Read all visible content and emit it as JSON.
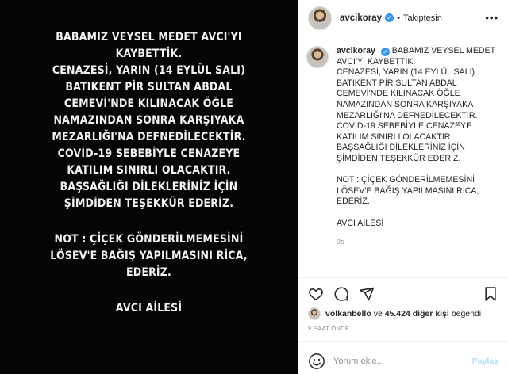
{
  "image": {
    "lines": [
      "BABAMIZ VEYSEL MEDET AVCI'YI",
      "KAYBETTİK.",
      "CENAZESİ, YARIN (14 EYLÜL SALI)",
      "BATIKENT PİR SULTAN ABDAL",
      "CEMEVİ'NDE KILINACAK ÖĞLE",
      "NAMAZINDAN SONRA KARŞIYAKA",
      "MEZARLIĞI'NA DEFNEDİLECEKTİR.",
      "COVİD-19 SEBEBİYLE CENAZEYE",
      "KATILIM SINIRLI OLACAKTIR.",
      "BAŞSAĞLIĞI DİLEKLERİNİZ İÇİN",
      "ŞİMDİDEN TEŞEKKÜR EDERİZ.",
      "",
      "NOT : ÇİÇEK GÖNDERİLMEMESİNİ",
      "LÖSEV'E BAĞIŞ YAPILMASINI RİCA,",
      "EDERİZ.",
      "",
      "AVCI AİLESİ"
    ]
  },
  "header": {
    "username": "avcikoray",
    "separator": "•",
    "follow_status": "Takiptesin",
    "more": "•••"
  },
  "caption": {
    "username": "avcikoray",
    "first_line": "BABAMIZ VEYSEL MEDET",
    "lines": [
      "AVCI'YI KAYBETTİK.",
      "CENAZESİ, YARIN (14 EYLÜL SALI)",
      "BATIKENT PİR SULTAN ABDAL",
      "CEMEVİ'NDE KILINACAK ÖĞLE",
      "NAMAZINDAN SONRA KARŞIYAKA",
      "MEZARLIĞI'NA DEFNEDİLECEKTİR.",
      "COVİD-19 SEBEBİYLE CENAZEYE",
      "KATILIM SINIRLI OLACAKTIR.",
      "BAŞSAĞLIĞI DİLEKLERİNİZ İÇİN",
      "ŞİMDİDEN TEŞEKKÜR EDERİZ.",
      "",
      "NOT : ÇİÇEK GÖNDERİLMEMESİNİ",
      "LÖSEV'E BAĞIŞ YAPILMASINI RİCA,",
      "EDERİZ.",
      "",
      "AVCI AİLESİ"
    ],
    "timestamp": "9s"
  },
  "likes": {
    "user": "volkanbello",
    "connector": "ve",
    "count_text": "45.424 diğer kişi",
    "suffix": "beğendi"
  },
  "time_ago": "9 SAAT ÖNCE",
  "comment": {
    "placeholder": "Yorum ekle...",
    "post_label": "Paylaş"
  },
  "colors": {
    "verified": "#3897f0",
    "post_button": "#b2dffc",
    "image_bg": "#050505"
  }
}
